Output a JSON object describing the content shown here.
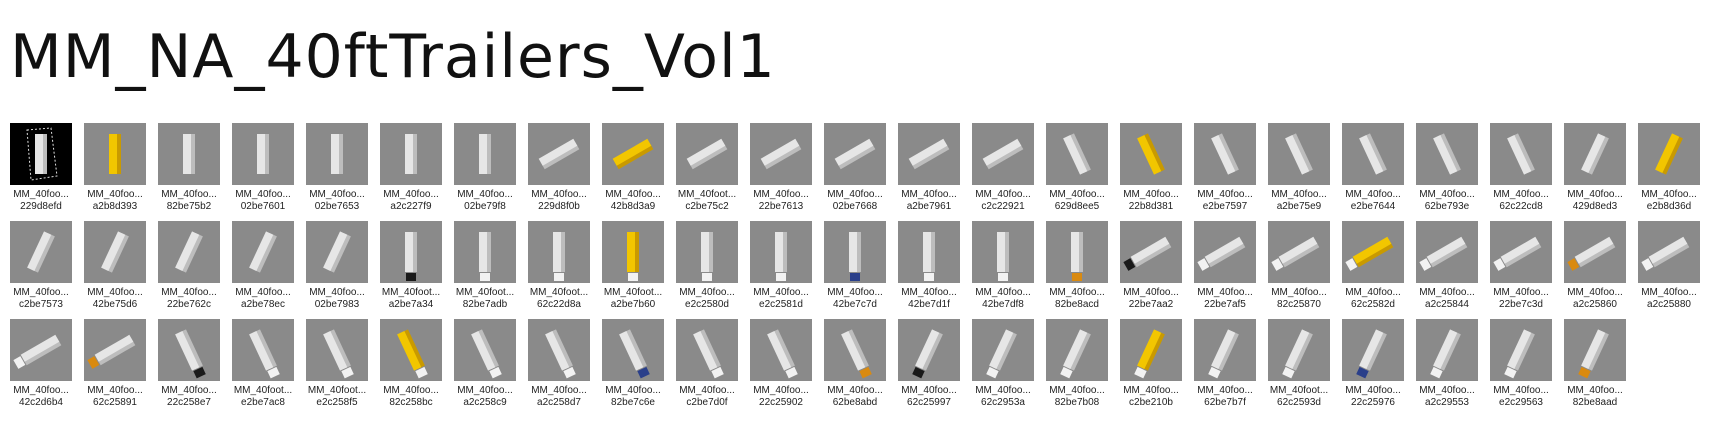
{
  "title": "MM_NA_40ftTrailers_Vol1",
  "colors": {
    "thumb_bg": "#8a8a8a",
    "trailer_white": "#e8e8e8",
    "trailer_yellow": "#f0c800",
    "selected_bg": "#000000"
  },
  "rows": [
    [
      {
        "name": "MM_40foo...",
        "hash": "229d8efd",
        "icon": "trailer-selected-wireframe",
        "color": "white",
        "view": "top",
        "selected": true
      },
      {
        "name": "MM_40foo...",
        "hash": "a2b8d393",
        "icon": "trailer-icon",
        "color": "yellow",
        "view": "top"
      },
      {
        "name": "MM_40foo...",
        "hash": "82be75b2",
        "icon": "trailer-icon",
        "color": "white",
        "view": "top"
      },
      {
        "name": "MM_40foo...",
        "hash": "02be7601",
        "icon": "trailer-icon",
        "color": "white",
        "view": "top"
      },
      {
        "name": "MM_40foo...",
        "hash": "02be7653",
        "icon": "trailer-icon",
        "color": "white",
        "view": "top"
      },
      {
        "name": "MM_40foo...",
        "hash": "a2c227f9",
        "icon": "trailer-icon",
        "color": "white",
        "view": "top"
      },
      {
        "name": "MM_40foo...",
        "hash": "02be79f8",
        "icon": "trailer-icon",
        "color": "white",
        "view": "top"
      },
      {
        "name": "MM_40foo...",
        "hash": "229d8f0b",
        "icon": "trailer-icon",
        "color": "white",
        "view": "diag"
      },
      {
        "name": "MM_40foo...",
        "hash": "42b8d3a9",
        "icon": "trailer-icon",
        "color": "yellow",
        "view": "diag"
      },
      {
        "name": "MM_40foot...",
        "hash": "c2be75c2",
        "icon": "trailer-icon",
        "color": "white",
        "view": "diag"
      },
      {
        "name": "MM_40foo...",
        "hash": "22be7613",
        "icon": "trailer-icon",
        "color": "white",
        "view": "diag"
      },
      {
        "name": "MM_40foo...",
        "hash": "02be7668",
        "icon": "trailer-icon",
        "color": "white",
        "view": "diag"
      },
      {
        "name": "MM_40foo...",
        "hash": "a2be7961",
        "icon": "trailer-icon",
        "color": "white",
        "view": "diag"
      },
      {
        "name": "MM_40foo...",
        "hash": "c2c22921",
        "icon": "trailer-icon",
        "color": "white",
        "view": "diag"
      },
      {
        "name": "MM_40foo...",
        "hash": "629d8ee5",
        "icon": "trailer-icon",
        "color": "white",
        "view": "diag2"
      },
      {
        "name": "MM_40foo...",
        "hash": "22b8d381",
        "icon": "trailer-icon",
        "color": "yellow",
        "view": "diag2"
      },
      {
        "name": "MM_40foo...",
        "hash": "e2be7597",
        "icon": "trailer-icon",
        "color": "white",
        "view": "diag2"
      },
      {
        "name": "MM_40foo...",
        "hash": "a2be75e9",
        "icon": "trailer-icon",
        "color": "white",
        "view": "diag2"
      },
      {
        "name": "MM_40foo...",
        "hash": "e2be7644",
        "icon": "trailer-icon",
        "color": "white",
        "view": "diag2"
      },
      {
        "name": "MM_40foo...",
        "hash": "62be793e",
        "icon": "trailer-icon",
        "color": "white",
        "view": "diag2"
      },
      {
        "name": "MM_40foo...",
        "hash": "62c22cd8",
        "icon": "trailer-icon",
        "color": "white",
        "view": "diag2"
      },
      {
        "name": "MM_40foo...",
        "hash": "429d8ed3",
        "icon": "trailer-icon",
        "color": "white",
        "view": "diag3"
      },
      {
        "name": "MM_40foo...",
        "hash": "e2b8d36d",
        "icon": "trailer-icon",
        "color": "yellow",
        "view": "diag3"
      }
    ],
    [
      {
        "name": "MM_40foo...",
        "hash": "c2be7573",
        "icon": "trailer-icon",
        "color": "white",
        "view": "diag3"
      },
      {
        "name": "MM_40foo...",
        "hash": "42be75d6",
        "icon": "trailer-icon",
        "color": "white",
        "view": "diag3"
      },
      {
        "name": "MM_40foo...",
        "hash": "22be762c",
        "icon": "trailer-icon",
        "color": "white",
        "view": "diag3"
      },
      {
        "name": "MM_40foo...",
        "hash": "a2be78ec",
        "icon": "trailer-icon",
        "color": "white",
        "view": "diag3"
      },
      {
        "name": "MM_40foo...",
        "hash": "02be7983",
        "icon": "trailer-icon",
        "color": "white",
        "view": "diag3"
      },
      {
        "name": "MM_40foot...",
        "hash": "a2be7a34",
        "icon": "truck-icon",
        "color": "white",
        "cab": "black",
        "view": "top"
      },
      {
        "name": "MM_40foot...",
        "hash": "82be7adb",
        "icon": "truck-icon",
        "color": "white",
        "cab": "white",
        "view": "top"
      },
      {
        "name": "MM_40foot...",
        "hash": "62c22d8a",
        "icon": "truck-icon",
        "color": "white",
        "cab": "white",
        "view": "top"
      },
      {
        "name": "MM_40foot...",
        "hash": "a2be7b60",
        "icon": "truck-icon",
        "color": "yellow",
        "cab": "white",
        "view": "top"
      },
      {
        "name": "MM_40foo...",
        "hash": "e2c2580d",
        "icon": "truck-icon",
        "color": "white",
        "cab": "white",
        "view": "top"
      },
      {
        "name": "MM_40foo...",
        "hash": "e2c2581d",
        "icon": "truck-icon",
        "color": "white",
        "cab": "white",
        "view": "top"
      },
      {
        "name": "MM_40foo...",
        "hash": "42be7c7d",
        "icon": "truck-icon",
        "color": "white",
        "cab": "blue",
        "view": "top"
      },
      {
        "name": "MM_40foo...",
        "hash": "42be7d1f",
        "icon": "truck-icon",
        "color": "white",
        "cab": "white",
        "view": "top"
      },
      {
        "name": "MM_40foo...",
        "hash": "42be7df8",
        "icon": "truck-icon",
        "color": "white",
        "cab": "white",
        "view": "top"
      },
      {
        "name": "MM_40foo...",
        "hash": "82be8acd",
        "icon": "truck-icon",
        "color": "white",
        "cab": "orange",
        "view": "top"
      },
      {
        "name": "MM_40foo...",
        "hash": "22be7aa2",
        "icon": "truck-icon",
        "color": "white",
        "cab": "black",
        "view": "diag"
      },
      {
        "name": "MM_40foo...",
        "hash": "22be7af5",
        "icon": "truck-icon",
        "color": "white",
        "cab": "white",
        "view": "diag"
      },
      {
        "name": "MM_40foo...",
        "hash": "82c25870",
        "icon": "truck-icon",
        "color": "white",
        "cab": "white",
        "view": "diag"
      },
      {
        "name": "MM_40foo...",
        "hash": "62c2582d",
        "icon": "truck-icon",
        "color": "yellow",
        "cab": "white",
        "view": "diag"
      },
      {
        "name": "MM_40foo...",
        "hash": "a2c25844",
        "icon": "truck-icon",
        "color": "white",
        "cab": "white",
        "view": "diag"
      },
      {
        "name": "MM_40foo...",
        "hash": "22be7c3d",
        "icon": "truck-icon",
        "color": "white",
        "cab": "white",
        "view": "diag"
      },
      {
        "name": "MM_40foo...",
        "hash": "a2c25860",
        "icon": "truck-icon",
        "color": "white",
        "cab": "orange",
        "view": "diag"
      },
      {
        "name": "MM_40foo...",
        "hash": "a2c25880",
        "icon": "truck-icon",
        "color": "white",
        "cab": "white",
        "view": "diag"
      }
    ],
    [
      {
        "name": "MM_40foo...",
        "hash": "42c2d6b4",
        "icon": "truck-icon",
        "color": "white",
        "cab": "white",
        "view": "diag"
      },
      {
        "name": "MM_40foo...",
        "hash": "62c25891",
        "icon": "truck-icon",
        "color": "white",
        "cab": "orange",
        "view": "diag"
      },
      {
        "name": "MM_40foo...",
        "hash": "22c258e7",
        "icon": "truck-icon",
        "color": "white",
        "cab": "black",
        "view": "diag2"
      },
      {
        "name": "MM_40foot...",
        "hash": "e2be7ac8",
        "icon": "truck-icon",
        "color": "white",
        "cab": "white",
        "view": "diag2"
      },
      {
        "name": "MM_40foot...",
        "hash": "e2c258f5",
        "icon": "truck-icon",
        "color": "white",
        "cab": "white",
        "view": "diag2"
      },
      {
        "name": "MM_40foo...",
        "hash": "82c258bc",
        "icon": "truck-icon",
        "color": "yellow",
        "cab": "white",
        "view": "diag2"
      },
      {
        "name": "MM_40foo...",
        "hash": "a2c258c9",
        "icon": "truck-icon",
        "color": "white",
        "cab": "white",
        "view": "diag2"
      },
      {
        "name": "MM_40foo...",
        "hash": "a2c258d7",
        "icon": "truck-icon",
        "color": "white",
        "cab": "white",
        "view": "diag2"
      },
      {
        "name": "MM_40foo...",
        "hash": "82be7c6e",
        "icon": "truck-icon",
        "color": "white",
        "cab": "blue",
        "view": "diag2"
      },
      {
        "name": "MM_40foo...",
        "hash": "c2be7d0f",
        "icon": "truck-icon",
        "color": "white",
        "cab": "white",
        "view": "diag2"
      },
      {
        "name": "MM_40foo...",
        "hash": "22c25902",
        "icon": "truck-icon",
        "color": "white",
        "cab": "white",
        "view": "diag2"
      },
      {
        "name": "MM_40foo...",
        "hash": "62be8abd",
        "icon": "truck-icon",
        "color": "white",
        "cab": "orange",
        "view": "diag2"
      },
      {
        "name": "MM_40foo...",
        "hash": "62c25997",
        "icon": "truck-icon",
        "color": "white",
        "cab": "black",
        "view": "diag3"
      },
      {
        "name": "MM_40foo...",
        "hash": "62c2953a",
        "icon": "truck-icon",
        "color": "white",
        "cab": "white",
        "view": "diag3"
      },
      {
        "name": "MM_40foo...",
        "hash": "82be7b08",
        "icon": "truck-icon",
        "color": "white",
        "cab": "white",
        "view": "diag3"
      },
      {
        "name": "MM_40foo...",
        "hash": "c2be210b",
        "icon": "truck-icon",
        "color": "yellow",
        "cab": "white",
        "view": "diag3"
      },
      {
        "name": "MM_40foo...",
        "hash": "62be7b7f",
        "icon": "truck-icon",
        "color": "white",
        "cab": "white",
        "view": "diag3"
      },
      {
        "name": "MM_40foot...",
        "hash": "62c2593d",
        "icon": "truck-icon",
        "color": "white",
        "cab": "white",
        "view": "diag3"
      },
      {
        "name": "MM_40foo...",
        "hash": "22c25976",
        "icon": "truck-icon",
        "color": "white",
        "cab": "blue",
        "view": "diag3"
      },
      {
        "name": "MM_40foo...",
        "hash": "a2c29553",
        "icon": "truck-icon",
        "color": "white",
        "cab": "white",
        "view": "diag3"
      },
      {
        "name": "MM_40foo...",
        "hash": "e2c29563",
        "icon": "truck-icon",
        "color": "white",
        "cab": "white",
        "view": "diag3"
      },
      {
        "name": "MM_40foo...",
        "hash": "82be8aad",
        "icon": "truck-icon",
        "color": "white",
        "cab": "orange",
        "view": "diag3"
      }
    ]
  ]
}
